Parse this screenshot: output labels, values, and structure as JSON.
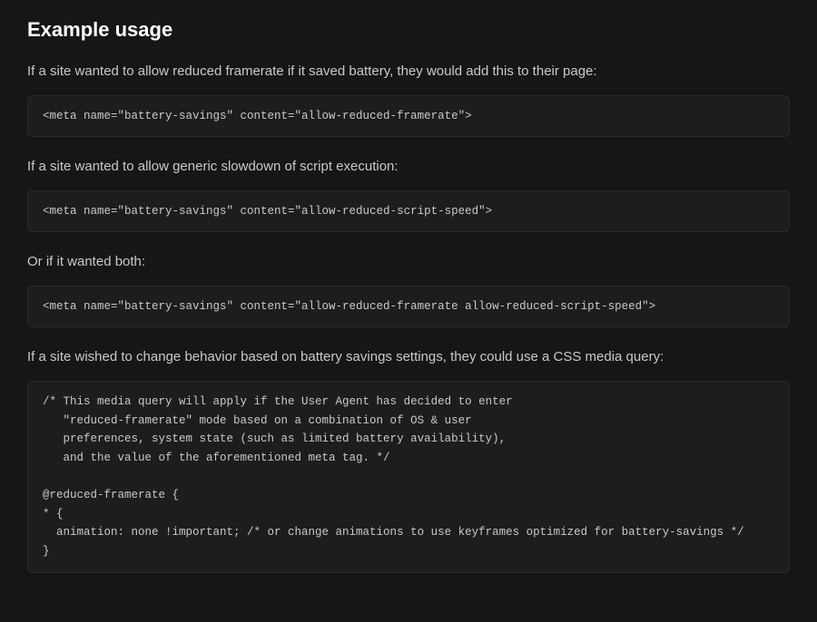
{
  "heading": "Example usage",
  "para1": "If a site wanted to allow reduced framerate if it saved battery, they would add this to their page:",
  "code1": "<meta name=\"battery-savings\" content=\"allow-reduced-framerate\">",
  "para2": "If a site wanted to allow generic slowdown of script execution:",
  "code2": "<meta name=\"battery-savings\" content=\"allow-reduced-script-speed\">",
  "para3": "Or if it wanted both:",
  "code3": "<meta name=\"battery-savings\" content=\"allow-reduced-framerate allow-reduced-script-speed\">",
  "para4": "If a site wished to change behavior based on battery savings settings, they could use a CSS media query:",
  "code4": "/* This media query will apply if the User Agent has decided to enter\n   \"reduced-framerate\" mode based on a combination of OS & user\n   preferences, system state (such as limited battery availability),\n   and the value of the aforementioned meta tag. */\n\n@reduced-framerate {\n* {\n  animation: none !important; /* or change animations to use keyframes optimized for battery-savings */\n}"
}
